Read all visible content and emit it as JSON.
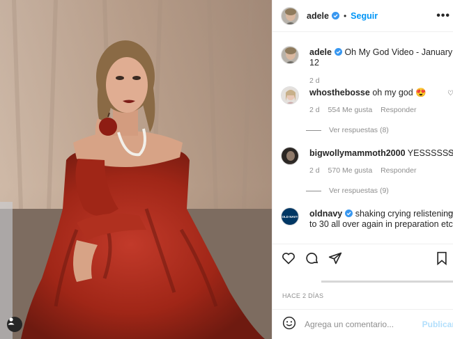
{
  "post": {
    "author": "adele",
    "follow_label": "Seguir",
    "dot": "•",
    "more_label": "•••",
    "caption": "Oh My God Video - January 12",
    "caption_age": "2 d",
    "time_label": "HACE 2 DÍAS"
  },
  "comments": [
    {
      "user": "whosthebosse",
      "text": "oh my god 😍",
      "age": "2 d",
      "likes": "554 Me gusta",
      "reply": "Responder",
      "view_replies": "Ver respuestas (8)"
    },
    {
      "user": "bigwollymammoth2000",
      "text": "YESSSSSS",
      "age": "2 d",
      "likes": "570 Me gusta",
      "reply": "Responder",
      "view_replies": "Ver respuestas (9)"
    },
    {
      "user": "oldnavy",
      "text": "shaking crying relistening to 30 all over again in preparation etc",
      "avatar_label": "OLD NAVY"
    }
  ],
  "composer": {
    "placeholder": "Agrega un comentario...",
    "publish_label": "Publicar"
  },
  "colors": {
    "accent": "#0095f6",
    "gown": "#a3281e",
    "backdrop": "#b8a28f"
  },
  "icons": [
    "verified-badge-icon",
    "more-options-icon",
    "heart-icon",
    "comment-icon",
    "share-icon",
    "bookmark-icon",
    "emoji-icon",
    "user-tag-icon"
  ]
}
